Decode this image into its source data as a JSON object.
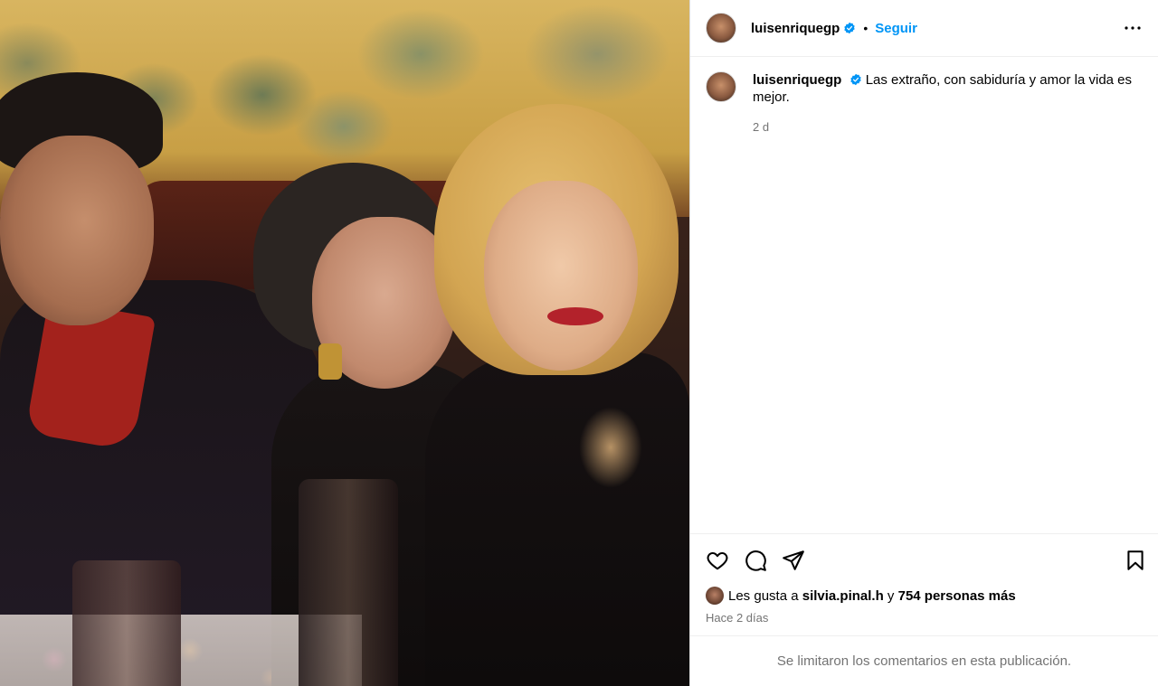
{
  "post": {
    "author": {
      "username": "luisenriquegp",
      "verified": true,
      "follow_label": "Seguir",
      "separator": "•"
    },
    "caption": {
      "username": "luisenriquegp",
      "text": "Las extraño, con sabiduría y amor la vida es mejor.",
      "age": "2 d"
    },
    "likes": {
      "prefix": "Les gusta a ",
      "liker": "silvia.pinal.h",
      "joiner": " y ",
      "others": "754 personas más"
    },
    "date": "Hace 2 días",
    "comments_notice": "Se limitaron los comentarios en esta publicación.",
    "icons": {
      "more": "more-options-icon",
      "like": "heart-icon",
      "comment": "comment-icon",
      "share": "share-icon",
      "save": "bookmark-icon",
      "verified": "verified-badge-icon"
    },
    "colors": {
      "accent": "#0095f6",
      "secondary_text": "#737373",
      "border": "#efefef"
    }
  }
}
